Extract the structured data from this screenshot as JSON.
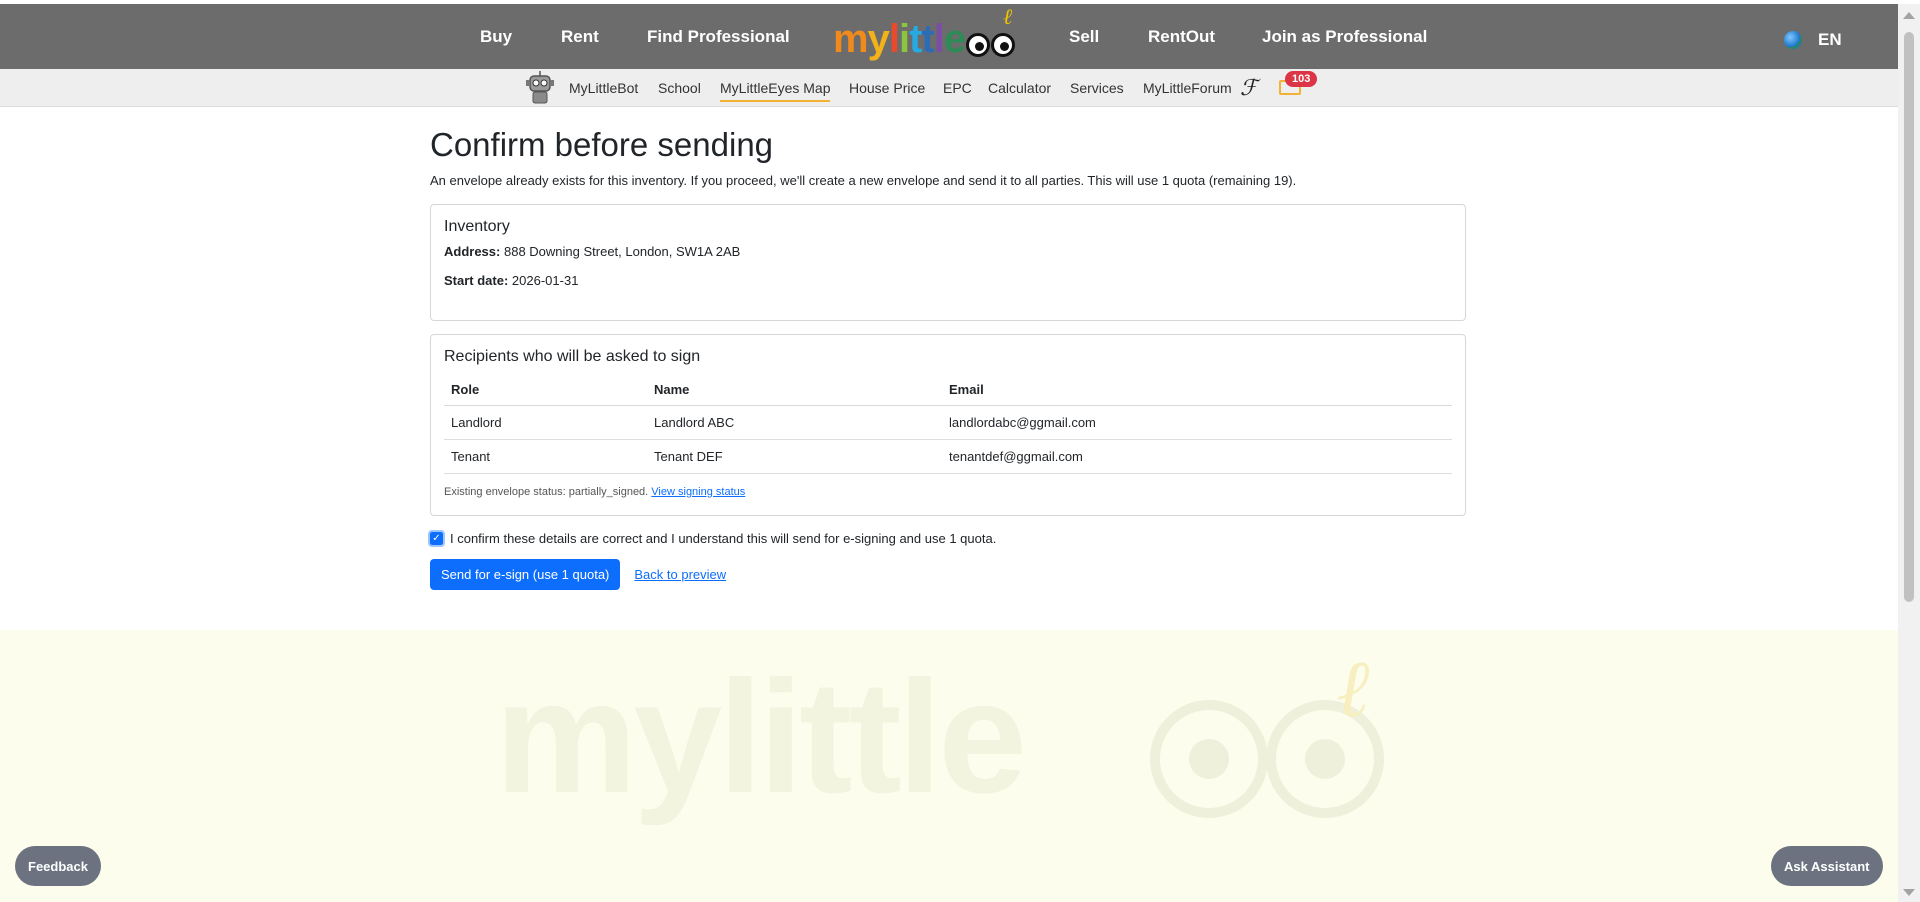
{
  "topnav": {
    "left_items": [
      "Buy",
      "Rent",
      "Find Professional"
    ],
    "right_items": [
      "Sell",
      "RentOut",
      "Join as Professional"
    ],
    "logo": "mylittle",
    "language": "EN"
  },
  "subnav": {
    "items": [
      "MyLittleBot",
      "School",
      "MyLittleEyes Map",
      "House Price",
      "EPC",
      "Calculator",
      "Services",
      "MyLittleForum"
    ],
    "active": "MyLittleEyes Map",
    "notification_count": "103"
  },
  "page": {
    "title": "Confirm before sending",
    "lead": "An envelope already exists for this inventory. If you proceed, we'll create a new envelope and send it to all parties. This will use 1 quota (remaining 19)."
  },
  "inventory": {
    "heading": "Inventory",
    "address_label": "Address:",
    "address": "888 Downing Street, London, SW1A 2AB",
    "start_label": "Start date:",
    "start_date": "2026-01-31"
  },
  "recipients": {
    "heading": "Recipients who will be asked to sign",
    "columns": [
      "Role",
      "Name",
      "Email"
    ],
    "rows": [
      [
        "Landlord",
        "Landlord ABC",
        "landlordabc@ggmail.com"
      ],
      [
        "Tenant",
        "Tenant DEF",
        "tenantdef@ggmail.com"
      ]
    ],
    "status_text": "Existing envelope status: partially_signed.",
    "status_link": "View signing status"
  },
  "confirm": {
    "checked": true,
    "label": "I confirm these details are correct and I understand this will send for e-signing and use 1 quota."
  },
  "actions": {
    "send": "Send for e-sign (use 1 quota)",
    "back": "Back to preview"
  },
  "floating": {
    "feedback": "Feedback",
    "assistant": "Ask Assistant"
  },
  "watermark": "mylittle",
  "colors": {
    "topbar": "#6c6c6c",
    "primary": "#0d6efd",
    "badge": "#dc3545",
    "accent": "#f2b233",
    "footer_bg": "#fcfdec"
  }
}
